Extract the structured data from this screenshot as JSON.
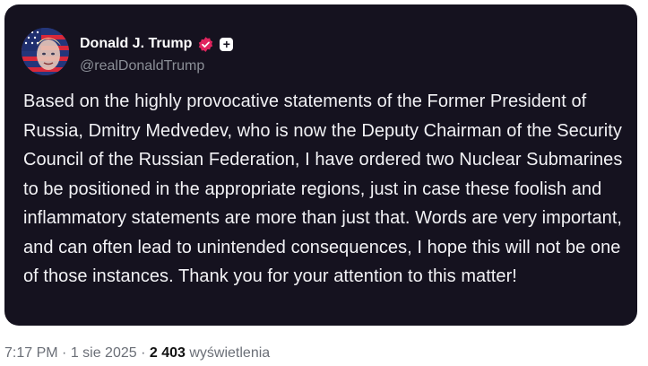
{
  "author": {
    "display_name": "Donald J. Trump",
    "handle": "@realDonaldTrump",
    "avatar_icon": "profile-photo-flag",
    "verified_icon": "verified-badge-icon",
    "verified_color": "#e0245e",
    "plus_icon": "plus-icon"
  },
  "post": {
    "text": "Based on the highly provocative statements of the Former President of Russia, Dmitry Medvedev, who is now the Deputy Chairman of the Security Council of the Russian Federation, I have ordered two Nuclear Submarines to be positioned in the appropriate regions, just in case these foolish and inflammatory statements are more than just that. Words are very important, and can often lead to unintended consequences, I hope this will not be one of those instances. Thank you for your attention to this matter!"
  },
  "meta": {
    "time": "7:17 PM",
    "separator": " · ",
    "date": "1 sie 2025",
    "views_count": "2 403",
    "views_label": " wyświetlenia"
  },
  "colors": {
    "card_background": "#15121f",
    "text": "#f2f2f5",
    "muted": "#8b8f97"
  }
}
